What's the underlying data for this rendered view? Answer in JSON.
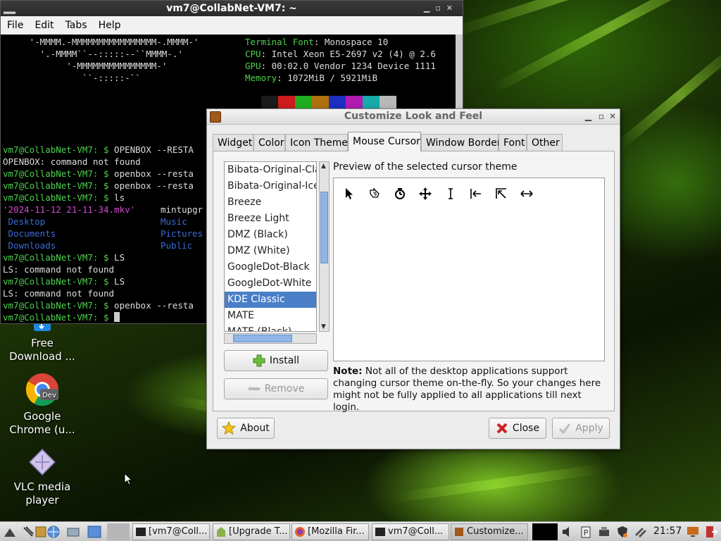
{
  "terminal": {
    "title": "vm7@CollabNet-VM7: ~",
    "menu": [
      "File",
      "Edit",
      "Tabs",
      "Help"
    ],
    "art_lines": [
      "     '-MMMM.-MMMMMMMMMMMMMMMM-.MMMM-'",
      "       '.-MMMM``--:::::--``MMMM-.'",
      "            '-MMMMMMMMMMMMMMM-'",
      "               ``-:::::-``"
    ],
    "info": [
      {
        "key": "Terminal Font",
        "value": "Monospace 10"
      },
      {
        "key": "CPU",
        "value": "Intel Xeon E5-2697 v2 (4) @ 2.6"
      },
      {
        "key": "GPU",
        "value": "00:02.0 Vendor 1234 Device 1111"
      },
      {
        "key": "Memory",
        "value": "1072MiB / 5921MiB"
      }
    ],
    "palette": [
      "#1a1a1a",
      "#cc1c1c",
      "#1fae1f",
      "#b0700e",
      "#1c2fc0",
      "#b01cb0",
      "#16aaa8",
      "#b8b8b8"
    ],
    "prompt": "vm7@CollabNet-VM7: $",
    "lines": [
      {
        "kind": "cmd",
        "text": "OPENBOX --RESTA"
      },
      {
        "kind": "out",
        "text": "OPENBOX: command not found"
      },
      {
        "kind": "cmd",
        "text": "openbox --resta"
      },
      {
        "kind": "cmd",
        "text": "openbox --resta"
      },
      {
        "kind": "cmd",
        "text": "ls"
      },
      {
        "kind": "ls1",
        "a": "'2024-11-12 21-11-34.mkv'",
        "b": "mintupgr"
      },
      {
        "kind": "ls2",
        "a": "Desktop",
        "b": "Music"
      },
      {
        "kind": "ls2",
        "a": "Documents",
        "b": "Pictures"
      },
      {
        "kind": "ls2",
        "a": "Downloads",
        "b": "Public"
      },
      {
        "kind": "cmd",
        "text": "LS"
      },
      {
        "kind": "out",
        "text": "LS: command not found"
      },
      {
        "kind": "cmd",
        "text": "LS"
      },
      {
        "kind": "out",
        "text": "LS: command not found"
      },
      {
        "kind": "cmd",
        "text": "openbox --resta"
      },
      {
        "kind": "cmd",
        "text": ""
      }
    ]
  },
  "desktop": {
    "icons": [
      {
        "name": "free-download-manager-icon",
        "label": "Free\nDownload ..."
      },
      {
        "name": "google-chrome-dev-icon",
        "label": "Google\nChrome (u..."
      },
      {
        "name": "vlc-icon",
        "label": "VLC media\nplayer"
      }
    ],
    "chrome_badge": "Dev"
  },
  "dialog": {
    "title": "Customize Look and Feel",
    "tabs": [
      "Widget",
      "Color",
      "Icon Theme",
      "Mouse Cursor",
      "Window Border",
      "Font",
      "Other"
    ],
    "active_tab": "Mouse Cursor",
    "themes": [
      "Bibata-Original-Classic",
      "Bibata-Original-Ice",
      "Breeze",
      "Breeze Light",
      "DMZ (Black)",
      "DMZ (White)",
      "GoogleDot-Black",
      "GoogleDot-White",
      "KDE Classic",
      "MATE",
      "MATE (Black)"
    ],
    "selected_theme": "KDE Classic",
    "preview_label": "Preview of the selected cursor theme",
    "cursors": [
      "arrow-cursor-icon",
      "hand-cursor-icon",
      "busy-cursor-icon",
      "move-cursor-icon",
      "text-cursor-icon",
      "left-side-cursor-icon",
      "top-left-corner-cursor-icon",
      "horizontal-resize-cursor-icon"
    ],
    "install_label": "Install",
    "remove_label": "Remove",
    "note_bold": "Note:",
    "note_text": " Not all of the desktop applications support changing cursor theme on-the-fly. So your changes here might not be fully applied to all applications till next login.",
    "about_label": "About",
    "close_label": "Close",
    "apply_label": "Apply"
  },
  "taskbar": {
    "tasks": [
      "[vm7@Coll...",
      "[Upgrade T...",
      "[Mozilla Fir...",
      "vm7@Coll...",
      "Customize..."
    ],
    "clock": "21:57"
  }
}
